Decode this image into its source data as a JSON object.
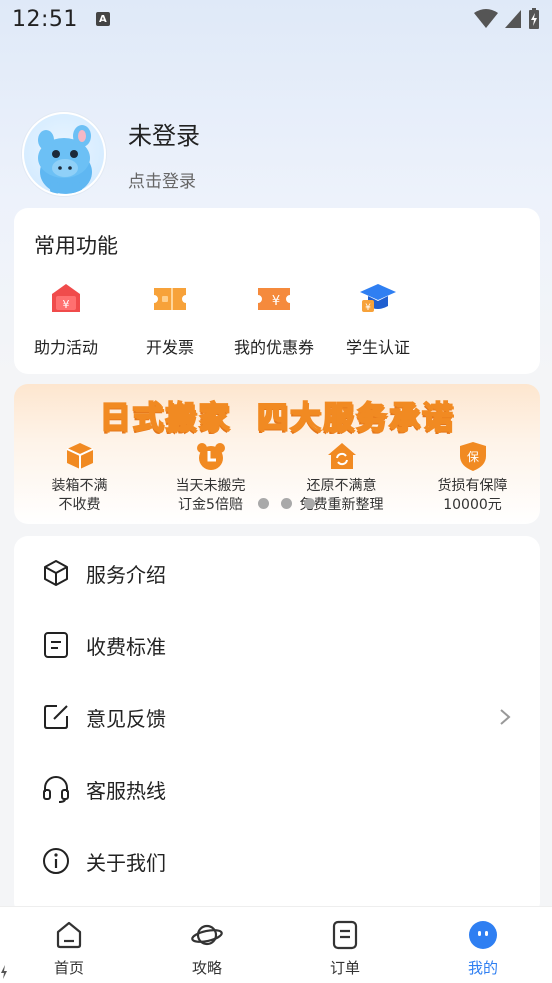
{
  "status_bar": {
    "time": "12:51",
    "notification_glyph": "A"
  },
  "profile": {
    "name": "未登录",
    "subtitle": "点击登录"
  },
  "common_functions": {
    "title": "常用功能",
    "items": [
      {
        "label": "助力活动",
        "icon": "gift-house-icon"
      },
      {
        "label": "开发票",
        "icon": "invoice-ticket-icon"
      },
      {
        "label": "我的优惠券",
        "icon": "coupon-icon"
      },
      {
        "label": "学生认证",
        "icon": "graduation-cap-icon"
      }
    ]
  },
  "banner": {
    "title": "日式搬家  四大服务承诺",
    "promises": [
      {
        "text": "装箱不满\n不收费",
        "icon": "box-icon"
      },
      {
        "text": "当天未搬完\n订金5倍赔",
        "icon": "clock-icon"
      },
      {
        "text": "还原不满意\n免费重新整理",
        "icon": "refresh-house-icon"
      },
      {
        "text": "货损有保障\n10000元",
        "icon": "shield-icon"
      }
    ],
    "carousel_dots": 3
  },
  "menu": {
    "items": [
      {
        "label": "服务介绍",
        "icon": "cube-icon"
      },
      {
        "label": "收费标准",
        "icon": "document-icon"
      },
      {
        "label": "意见反馈",
        "icon": "edit-icon"
      },
      {
        "label": "客服热线",
        "icon": "headset-icon"
      },
      {
        "label": "关于我们",
        "icon": "info-icon"
      }
    ]
  },
  "tabbar": {
    "tabs": [
      {
        "label": "首页",
        "icon": "home-icon"
      },
      {
        "label": "攻略",
        "icon": "planet-icon"
      },
      {
        "label": "订单",
        "icon": "order-icon"
      },
      {
        "label": "我的",
        "icon": "me-icon"
      }
    ],
    "active_index": 3
  },
  "colors": {
    "accent": "#2f7ff2",
    "banner_orange": "#f18a22",
    "func_red": "#f04b4b",
    "func_orange": "#f7a23a",
    "func_blue": "#2f7ff2"
  }
}
